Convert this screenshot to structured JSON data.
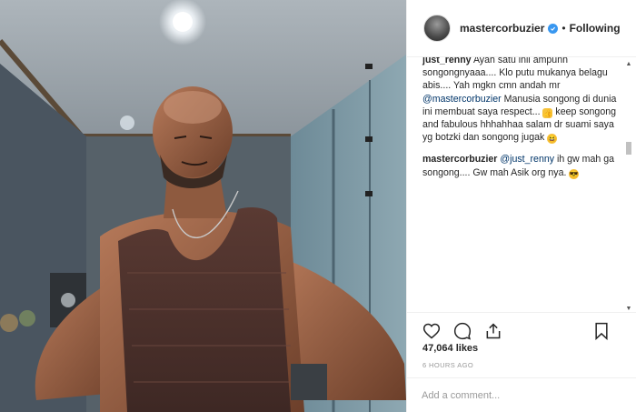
{
  "post": {
    "username": "mastercorbuzier",
    "separator": "•",
    "follow_status": "Following"
  },
  "comments": [
    {
      "author": "just_renny",
      "text_a": "Ayah satu inii ampunn songongnyaaa.... Klo putu mukanya belagu abis.... Yah mgkn cmn andah mr ",
      "mention": "@mastercorbuzier",
      "text_b": " Manusia songong di dunia ini membuat saya respect... ",
      "text_c": " keep songong and fabulous hhhahhaa salam dr suami saya yg botzki dan songong jugak ",
      "emoji_1": "thumbs-up-emoji",
      "emoji_2": "laughing-emoji"
    },
    {
      "author": "mastercorbuzier",
      "mention": "@just_renny",
      "text": " ih gw mah ga songong.... Gw mah Asik org nya. ",
      "emoji": "sunglasses-emoji"
    }
  ],
  "stats": {
    "likes": "47,064 likes",
    "time": "6 HOURS AGO"
  },
  "comment_box": {
    "placeholder": "Add a comment..."
  },
  "icons": {
    "like": "heart-icon",
    "comment": "comment-icon",
    "share": "share-icon",
    "save": "bookmark-icon",
    "verified": "verified-badge-icon"
  },
  "colors": {
    "verified": "#3897f0",
    "mention": "#003569",
    "border": "#efefef",
    "muted": "#999999"
  }
}
